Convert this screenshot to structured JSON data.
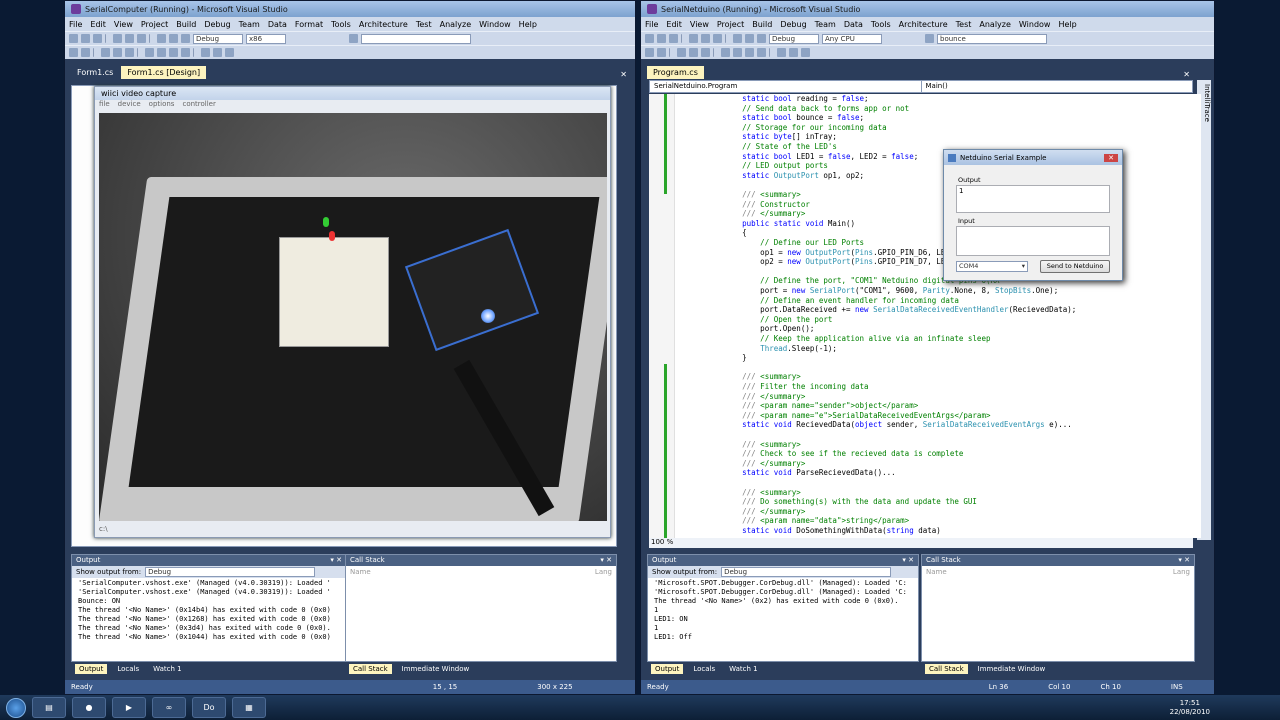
{
  "left_window": {
    "title": "SerialComputer (Running) - Microsoft Visual Studio",
    "menu": [
      "File",
      "Edit",
      "View",
      "Project",
      "Build",
      "Debug",
      "Team",
      "Data",
      "Format",
      "Tools",
      "Architecture",
      "Test",
      "Analyze",
      "Window",
      "Help"
    ],
    "toolbar": {
      "config": "Debug",
      "platform": "x86",
      "find": ""
    },
    "tabs": [
      "Form1.cs",
      "Form1.cs [Design]"
    ],
    "capture": {
      "title": "wiici video capture",
      "menu": [
        "file",
        "device",
        "options",
        "controller"
      ],
      "footer": "c:\\"
    },
    "output": {
      "header": "Output",
      "show_from_label": "Show output from:",
      "show_from_value": "Debug",
      "lines": [
        "'SerialComputer.vshost.exe' (Managed (v4.0.30319)): Loaded '",
        "'SerialComputer.vshost.exe' (Managed (v4.0.30319)): Loaded '",
        "Bounce: ON",
        "The thread '<No Name>' (0x14b4) has exited with code 0 (0x0)",
        "The thread '<No Name>' (0x1268) has exited with code 0 (0x0)",
        "The thread '<No Name>' (0x3d4) has exited with code 0 (0x0).",
        "The thread '<No Name>' (0x1044) has exited with code 0 (0x0)"
      ]
    },
    "callstack": {
      "header": "Call Stack",
      "col_name": "Name",
      "col_lang": "Lang"
    },
    "bottom_tabs_left": [
      "Output",
      "Locals",
      "Watch 1"
    ],
    "bottom_tabs_right": [
      "Call Stack",
      "Immediate Window"
    ],
    "status": {
      "left": "Ready",
      "pos": "15 , 15",
      "size": "300 x 225"
    }
  },
  "right_window": {
    "title": "SerialNetduino (Running) - Microsoft Visual Studio",
    "menu": [
      "File",
      "Edit",
      "View",
      "Project",
      "Build",
      "Debug",
      "Team",
      "Data",
      "Tools",
      "Architecture",
      "Test",
      "Analyze",
      "Window",
      "Help"
    ],
    "toolbar": {
      "config": "Debug",
      "platform": "Any CPU",
      "find": "bounce"
    },
    "tabs": [
      "Program.cs"
    ],
    "nav_left": "SerialNetduino.Program",
    "nav_right": "Main()",
    "side_label": "IntelliTrace",
    "code_lines": [
      "        static bool reading = false;",
      "        // Send data back to forms app or not",
      "        static bool bounce = false;",
      "        // Storage for our incoming data",
      "        static byte[] inTray;",
      "        // State of the LED's",
      "        static bool LED1 = false, LED2 = false;",
      "        // LED output ports",
      "        static OutputPort op1, op2;",
      "",
      "        /// <summary>",
      "        /// Constructor",
      "        /// </summary>",
      "        public static void Main()",
      "        {",
      "            // Define our LED Ports",
      "            op1 = new OutputPort(Pins.GPIO_PIN_D6, LED1);",
      "            op2 = new OutputPort(Pins.GPIO_PIN_D7, LED2);",
      "",
      "            // Define the port, \"COM1\" Netduino digital pins 0(RX",
      "            port = new SerialPort(\"COM1\", 9600, Parity.None, 8, StopBits.One);",
      "            // Define an event handler for incoming data",
      "            port.DataReceived += new SerialDataReceivedEventHandler(RecievedData);",
      "            // Open the port",
      "            port.Open();",
      "            // Keep the application alive via an infinate sleep",
      "            Thread.Sleep(-1);",
      "        }",
      "",
      "        /// <summary>",
      "        /// Filter the incoming data",
      "        /// </summary>",
      "        /// <param name=\"sender\">object</param>",
      "        /// <param name=\"e\">SerialDataReceivedEventArgs</param>",
      "        static void RecievedData(object sender, SerialDataReceivedEventArgs e)...",
      "",
      "        /// <summary>",
      "        /// Check to see if the recieved data is complete",
      "        /// </summary>",
      "        static void ParseRecievedData()...",
      "",
      "        /// <summary>",
      "        /// Do something(s) with the data and update the GUI",
      "        /// </summary>",
      "        /// <param name=\"data\">string</param>",
      "        static void DoSomethingWithData(string data)"
    ],
    "zoom": "100 %",
    "output": {
      "header": "Output",
      "show_from_label": "Show output from:",
      "show_from_value": "Debug",
      "lines": [
        "'Microsoft.SPOT.Debugger.CorDebug.dll' (Managed): Loaded 'C:",
        "'Microsoft.SPOT.Debugger.CorDebug.dll' (Managed): Loaded 'C:",
        "The thread '<No Name>' (0x2) has exited with code 0 (0x0).",
        "1",
        "LED1: ON",
        "1",
        "LED1: Off"
      ]
    },
    "callstack": {
      "header": "Call Stack",
      "col_name": "Name",
      "col_lang": "Lang"
    },
    "bottom_tabs_left": [
      "Output",
      "Locals",
      "Watch 1"
    ],
    "bottom_tabs_right": [
      "Call Stack",
      "Immediate Window"
    ],
    "status": {
      "left": "Ready",
      "ln": "Ln 36",
      "col": "Col 10",
      "ch": "Ch 10",
      "ins": "INS"
    }
  },
  "netduino_dialog": {
    "title": "Netduino Serial Example",
    "output_label": "Output",
    "output_value": "1",
    "input_label": "Input",
    "port_value": "COM4",
    "send_button": "Send to Netduino"
  },
  "taskbar": {
    "items": [
      "Do"
    ],
    "time": "17:51",
    "date": "22/08/2010"
  }
}
